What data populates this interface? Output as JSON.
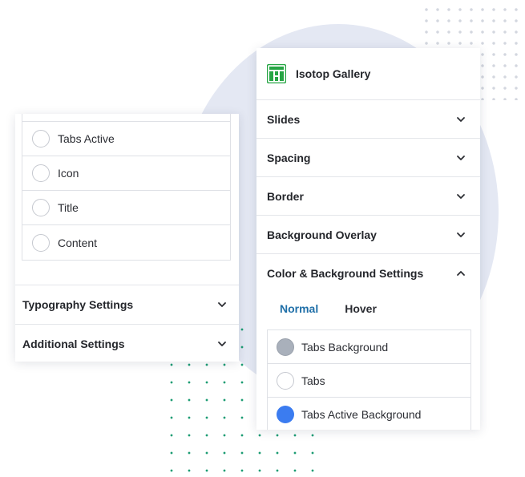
{
  "left_panel": {
    "radio_items": [
      {
        "label": "Tabs Active"
      },
      {
        "label": "Icon"
      },
      {
        "label": "Title"
      },
      {
        "label": "Content"
      }
    ],
    "sections": [
      {
        "title": "Typography Settings",
        "icon": "chevron-down-icon"
      },
      {
        "title": "Additional Settings",
        "icon": "chevron-down-icon"
      }
    ]
  },
  "right_panel": {
    "app_title": "Isotop Gallery",
    "app_icon": "gallery-grid-icon",
    "app_icon_color": "#26a544",
    "accordion": [
      {
        "title": "Slides",
        "state": "collapsed"
      },
      {
        "title": "Spacing",
        "state": "collapsed"
      },
      {
        "title": "Border",
        "state": "collapsed"
      },
      {
        "title": "Background Overlay",
        "state": "collapsed"
      },
      {
        "title": "Color & Background Settings",
        "state": "expanded"
      }
    ],
    "tabs": [
      {
        "label": "Normal",
        "active": true
      },
      {
        "label": "Hover",
        "active": false
      }
    ],
    "color_settings": [
      {
        "label": "Tabs Background",
        "color": "#a9b0bb"
      },
      {
        "label": "Tabs",
        "color": "#ffffff"
      },
      {
        "label": "Tabs Active Background",
        "color": "#3b7cf0"
      }
    ]
  },
  "colors": {
    "accent_tab": "#1f6fa8",
    "background_blob": "#e4e8f3",
    "decor_dots": "#1d9d74"
  }
}
